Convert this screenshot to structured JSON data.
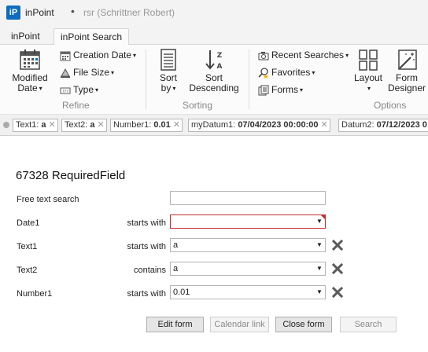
{
  "window": {
    "app_icon": "iP",
    "app_name": "inPoint",
    "separator": "•",
    "doc_title": "rsr (Schrittner Robert)"
  },
  "tabs": [
    {
      "label": "inPoint",
      "active": false
    },
    {
      "label": "inPoint Search",
      "active": true
    }
  ],
  "ribbon": {
    "modified_date": "Modified\nDate",
    "modified_date_l1": "Modified",
    "modified_date_l2": "Date",
    "creation_date": "Creation Date",
    "file_size": "File Size",
    "type": "Type",
    "refine_group": "Refine",
    "sort_by_l1": "Sort",
    "sort_by_l2": "by",
    "sort_desc_l1": "Sort",
    "sort_desc_l2": "Descending",
    "sorting_group": "Sorting",
    "recent_searches": "Recent Searches",
    "favorites": "Favorites",
    "forms": "Forms",
    "layout": "Layout",
    "form_designer_l1": "Form",
    "form_designer_l2": "Designer",
    "options_group": "Options"
  },
  "filters": [
    {
      "field": "Text1:",
      "value": "a"
    },
    {
      "field": "Text2:",
      "value": "a"
    },
    {
      "field": "Number1:",
      "value": "0.01"
    },
    {
      "field": "myDatum1:",
      "value": "07/04/2023 00:00:00"
    },
    {
      "field": "Datum2:",
      "value": "07/12/2023 0"
    }
  ],
  "form": {
    "title": "67328 RequiredField",
    "rows": [
      {
        "label": "Free text search",
        "operator": "",
        "value": ""
      },
      {
        "label": "Date1",
        "operator": "starts with",
        "value": ""
      },
      {
        "label": "Text1",
        "operator": "starts with",
        "value": "a"
      },
      {
        "label": "Text2",
        "operator": "contains",
        "value": "a"
      },
      {
        "label": "Number1",
        "operator": "starts with",
        "value": "0.01"
      }
    ]
  },
  "buttons": {
    "edit_form": "Edit form",
    "calendar_link": "Calendar link",
    "close_form": "Close form",
    "search": "Search"
  },
  "colors": {
    "accent": "#0f6cbd",
    "required_border": "#c42b2b",
    "clear_icon": "#5a5a5a"
  }
}
